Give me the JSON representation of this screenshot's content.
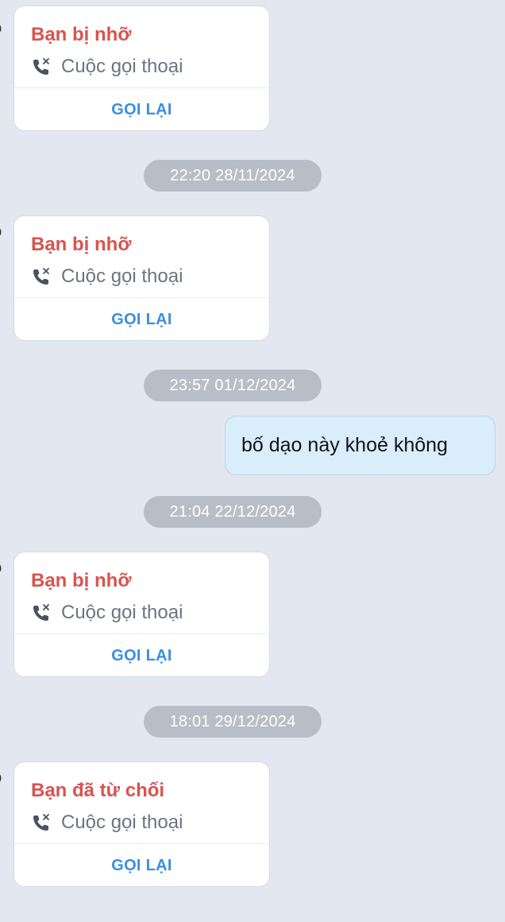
{
  "calls": [
    {
      "status": "Bạn bị nhỡ",
      "type": "Cuộc gọi thoại",
      "action": "GỌI LẠI"
    },
    {
      "status": "Bạn bị nhỡ",
      "type": "Cuộc gọi thoại",
      "action": "GỌI LẠI"
    },
    {
      "status": "Bạn bị nhỡ",
      "type": "Cuộc gọi thoại",
      "action": "GỌI LẠI"
    },
    {
      "status": "Bạn đã từ chối",
      "type": "Cuộc gọi thoại",
      "action": "GỌI LẠI"
    }
  ],
  "timestamps": [
    "22:20 28/11/2024",
    "23:57 01/12/2024",
    "21:04 22/12/2024",
    "18:01 29/12/2024"
  ],
  "messages": [
    {
      "direction": "sent",
      "text": "bố dạo này khoẻ không"
    }
  ],
  "colors": {
    "background": "#e3e8f0",
    "missed": "#d9534f",
    "action": "#3b8ee0",
    "sent_bubble": "#d9edfb",
    "timestamp_pill": "#b8bec7"
  },
  "icons": {
    "call_type": "missed-call-phone-icon"
  }
}
